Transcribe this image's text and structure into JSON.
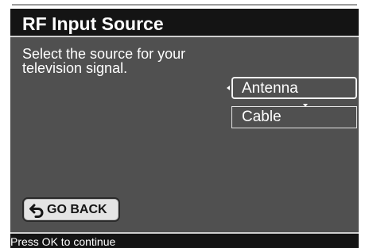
{
  "dialog": {
    "title": "RF Input Source",
    "prompt_lines": [
      "Select the source for your",
      "television signal."
    ]
  },
  "options": [
    {
      "label": "Antenna",
      "selected": true
    },
    {
      "label": "Cable",
      "selected": false
    }
  ],
  "back_button": {
    "label": "GO BACK",
    "icon": "back-arrow-icon"
  },
  "footer": {
    "hint": "Press OK to continue"
  },
  "colors": {
    "panel": "#505050",
    "title_bar": "#141414",
    "text": "#ffffff",
    "button_face": "#e4e4e4"
  }
}
